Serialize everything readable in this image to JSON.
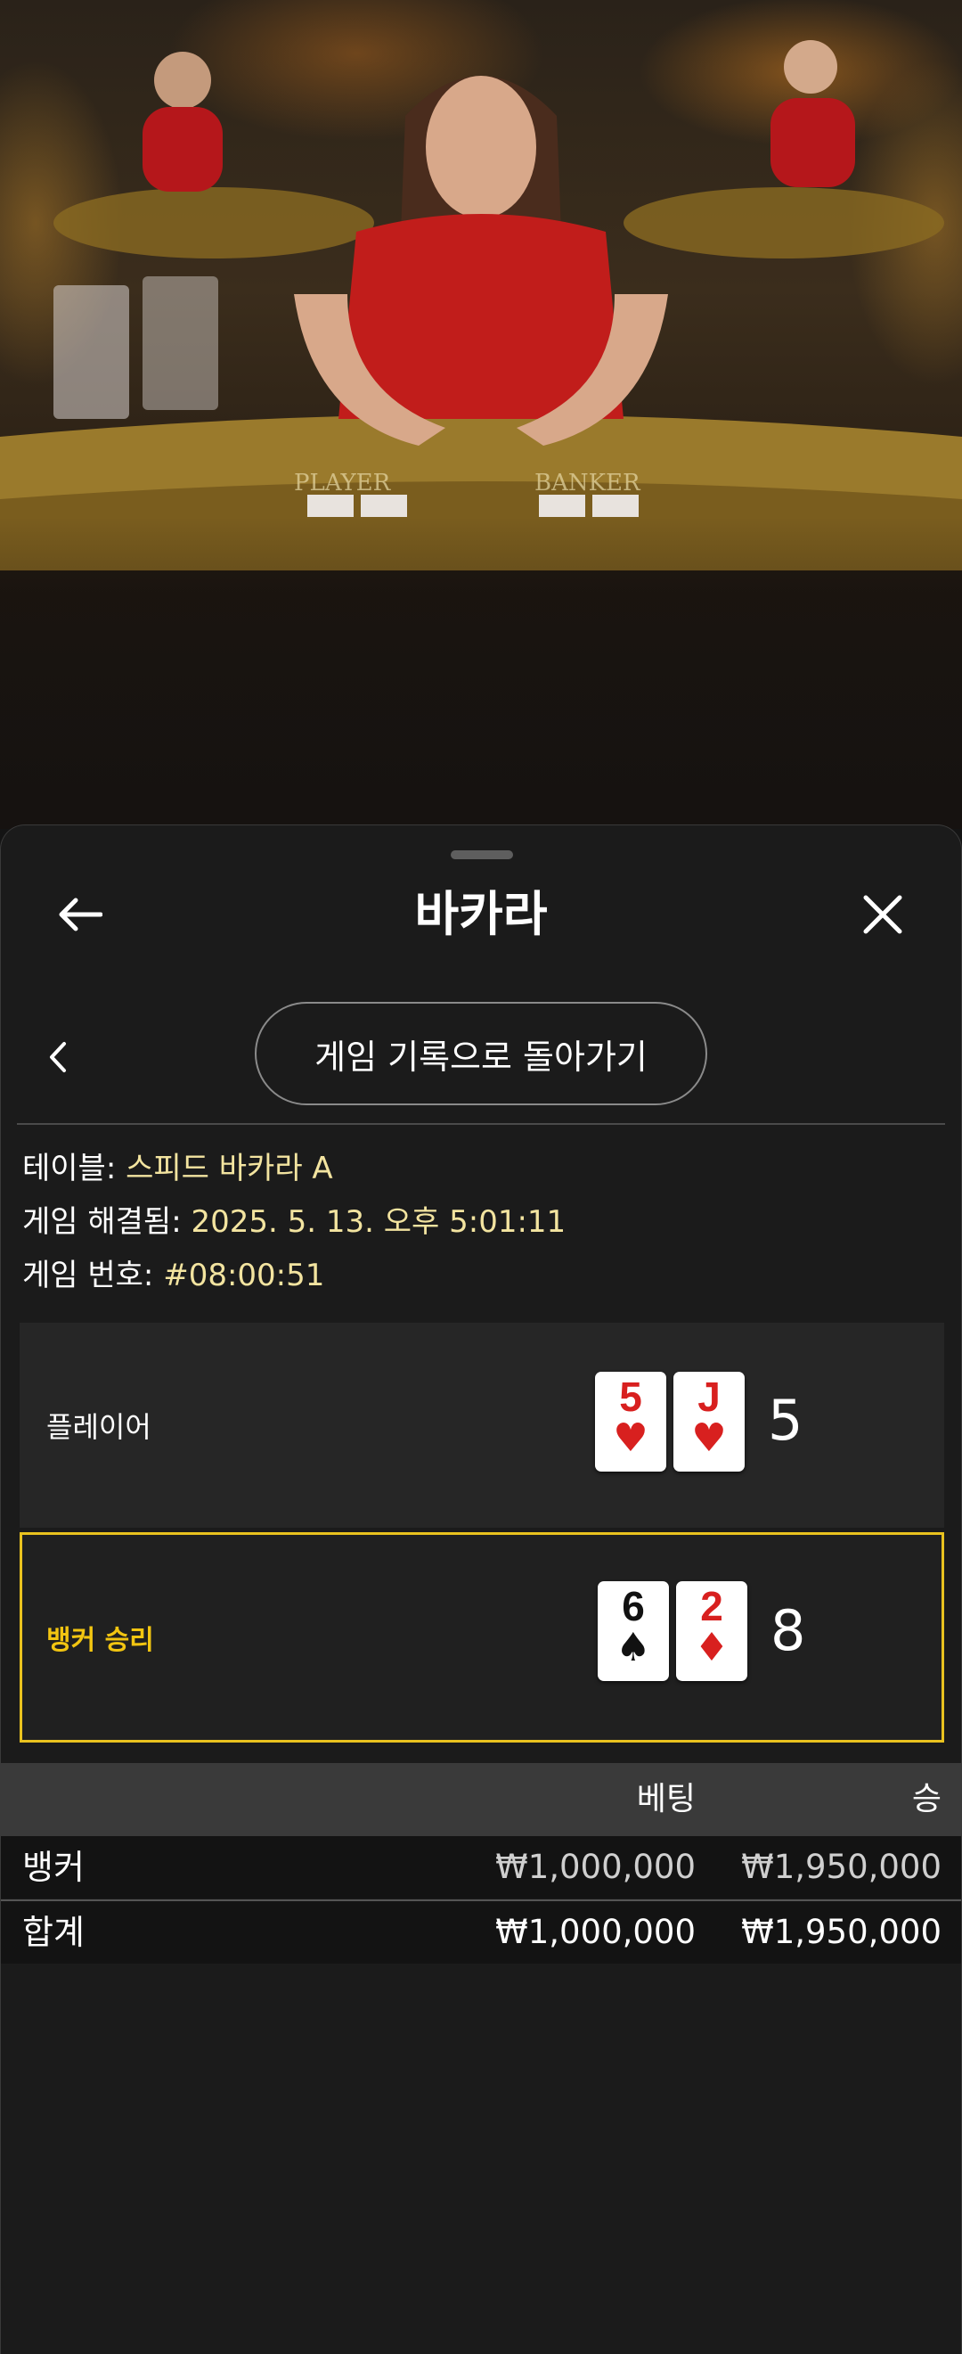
{
  "header": {
    "title": "바카라"
  },
  "subnav": {
    "back_to_history_label": "게임 기록으로 돌아가기"
  },
  "info": {
    "table_label": "테이블:",
    "table_value": "스피드 바카라 A",
    "resolved_label": "게임 해결됨:",
    "resolved_value": "2025. 5. 13. 오후 5:01:11",
    "number_label": "게임 번호:",
    "number_value": "#08:00:51"
  },
  "results": {
    "player": {
      "label": "플레이어",
      "cards": [
        {
          "rank": "5",
          "suit": "♥",
          "color": "red"
        },
        {
          "rank": "J",
          "suit": "♥",
          "color": "red"
        }
      ],
      "score": "5"
    },
    "banker": {
      "label": "뱅커 승리",
      "cards": [
        {
          "rank": "6",
          "suit": "♠",
          "color": "black"
        },
        {
          "rank": "2",
          "suit": "♦",
          "color": "red"
        }
      ],
      "score": "8",
      "highlight_color": "#e9c21f"
    }
  },
  "bets": {
    "columns": {
      "bet": "베팅",
      "win": "승"
    },
    "rows": [
      {
        "name": "뱅커",
        "bet": "₩1,000,000",
        "win": "₩1,950,000"
      }
    ],
    "total": {
      "name": "합계",
      "bet": "₩1,000,000",
      "win": "₩1,950,000"
    }
  },
  "video": {
    "table_text_player": "PLAYER",
    "table_text_banker": "BANKER"
  },
  "colors": {
    "accent_yellow": "#f2c511",
    "info_value": "#f3e4a0",
    "sheet_bg": "#1b1b1b"
  }
}
